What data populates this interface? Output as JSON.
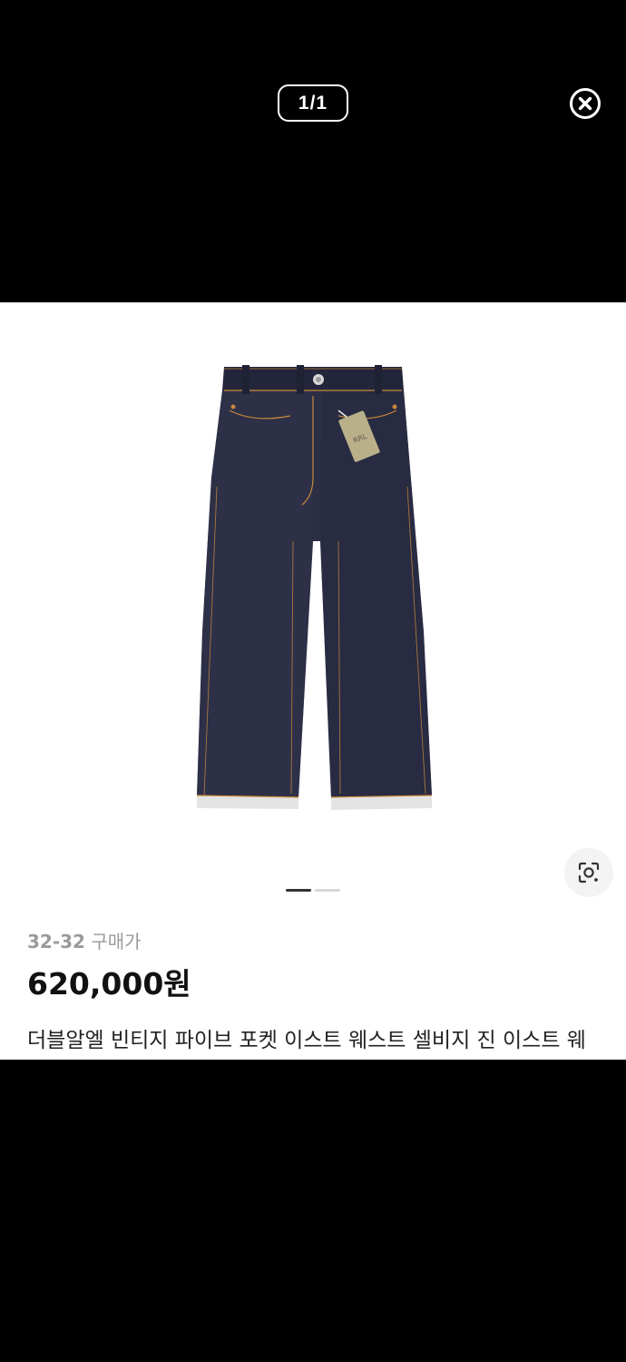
{
  "viewer": {
    "counter": "1/1",
    "close_icon": "close-circle-icon"
  },
  "product": {
    "image_alt": "product-image-jeans",
    "size": "32-32",
    "purchase_label": "구매가",
    "price": "620,000원",
    "title": "더블알엘 빈티지 파이브 포켓 이스트 웨스트 셀비지 진 이스트 웨",
    "lens_icon": "lens-search-icon"
  },
  "carousel": {
    "count": 2,
    "active_index": 0
  },
  "colors": {
    "background": "#000000",
    "card": "#ffffff",
    "denim": "#2b2e45",
    "stitch": "#c8893b"
  }
}
